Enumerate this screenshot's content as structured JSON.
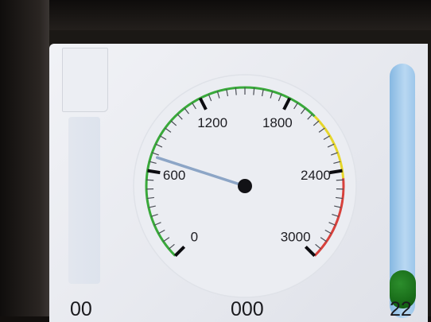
{
  "gauge": {
    "min": 0,
    "max": 3000,
    "value": 700,
    "labels": [
      "0",
      "600",
      "1200",
      "1800",
      "2400",
      "3000"
    ],
    "zones": [
      {
        "from": 0,
        "to": 2000,
        "color": "#39a93a"
      },
      {
        "from": 2000,
        "to": 2450,
        "color": "#e6d62a"
      },
      {
        "from": 2450,
        "to": 3000,
        "color": "#d8413c"
      }
    ],
    "needle_color": "#8ca5c6",
    "hub_color": "#121216"
  },
  "footer": {
    "left": "00",
    "center": "000",
    "right": "22"
  },
  "slider": {
    "level": 0.03,
    "track_color": "#9ec8ec",
    "knob_color": "#1f7a1f"
  }
}
